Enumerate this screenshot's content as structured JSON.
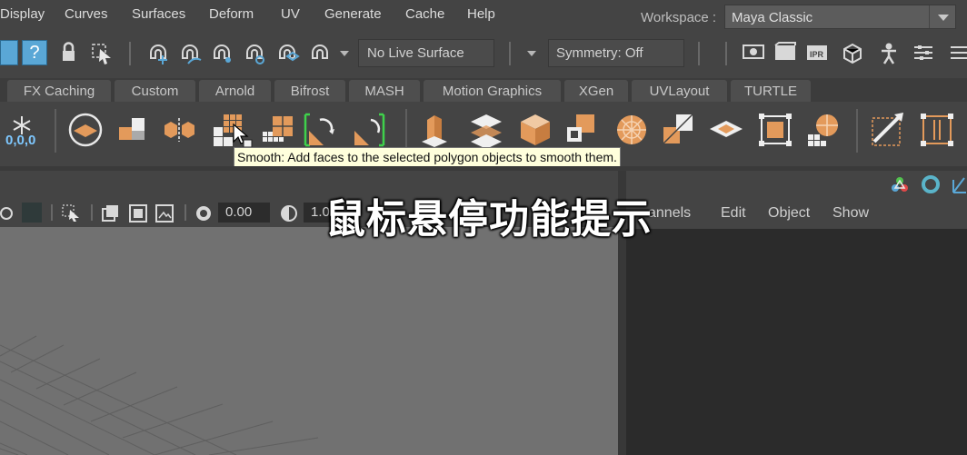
{
  "menubar": {
    "items": [
      "Display",
      "Curves",
      "Surfaces",
      "Deform",
      "UV",
      "Generate",
      "Cache",
      "Help"
    ],
    "workspace_label": "Workspace :",
    "workspace_value": "Maya Classic"
  },
  "statusline": {
    "live_surface": "No Live Surface",
    "symmetry": "Symmetry: Off"
  },
  "shelf_tabs": [
    "FX Caching",
    "Custom",
    "Arnold",
    "Bifrost",
    "MASH",
    "Motion Graphics",
    "XGen",
    "UVLayout",
    "TURTLE"
  ],
  "shelf": {
    "snow_value": "0,0,0"
  },
  "tooltip": "Smooth: Add faces to the selected polygon objects to smooth them.",
  "panel_toolbar": {
    "value_a": "0.00",
    "value_b": "1.0"
  },
  "channel_box": {
    "menu": [
      "annels",
      "Edit",
      "Object",
      "Show"
    ]
  },
  "caption": "鼠标悬停功能提示",
  "colors": {
    "accent_orange": "#e39a5b",
    "icon_white": "#efefef",
    "highlight_blue": "#5aa7d6",
    "tooltip_bg": "#ffffdc",
    "channel_bg": "#2b2b2b",
    "viewport_bg": "#717171"
  }
}
